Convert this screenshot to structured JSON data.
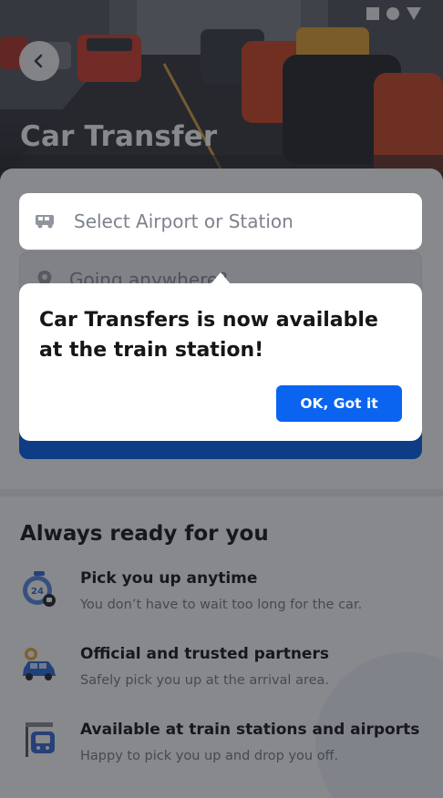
{
  "header": {
    "title": "Car Transfer",
    "back_icon": "chevron-left-icon",
    "status_icons": [
      "square-icon",
      "circle-icon",
      "triangle-icon"
    ]
  },
  "search": {
    "pickup_placeholder": "Select Airport or Station",
    "pickup_icon": "van-icon",
    "destination_placeholder": "Going anywhere?",
    "destination_icon": "pin-icon"
  },
  "tooltip": {
    "message": "Car Transfers is now available at the train station!",
    "button_label": "OK, Got it"
  },
  "features": {
    "title": "Always ready for you",
    "items": [
      {
        "icon": "clock-24-icon",
        "title": "Pick you up anytime",
        "desc": "You don’t have to wait too long for the car."
      },
      {
        "icon": "car-badge-icon",
        "title": "Official and trusted partners",
        "desc": "Safely pick you up at the arrival area."
      },
      {
        "icon": "train-sign-icon",
        "title": "Available at train stations and airports",
        "desc": "Happy to pick you up and drop you off."
      }
    ]
  },
  "colors": {
    "primary": "#0a64f0",
    "text_dark": "#1c1d21",
    "text_muted": "#7a7f88",
    "overlay": "rgba(18,20,26,0.50)"
  }
}
